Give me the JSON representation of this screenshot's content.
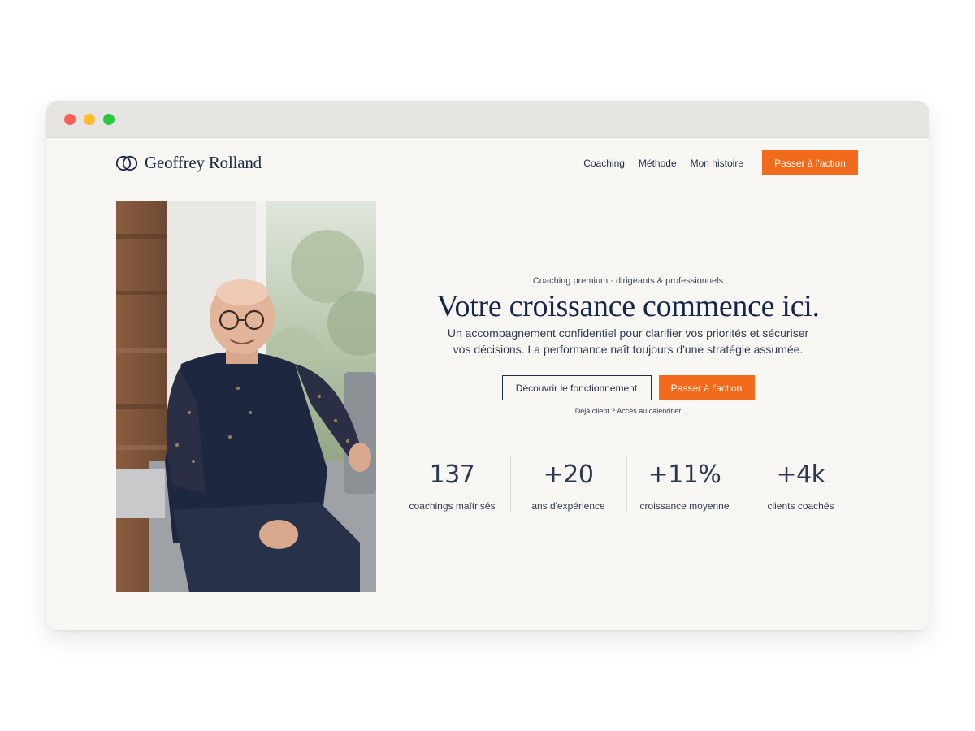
{
  "brand": {
    "name": "Geoffrey Rolland"
  },
  "nav": {
    "links": [
      "Coaching",
      "Méthode",
      "Mon histoire"
    ],
    "cta": "Passer à l'action"
  },
  "hero": {
    "eyebrow": "Coaching premium · dirigeants & professionnels",
    "title": "Votre croissance commence ici.",
    "subtitle": "Un accompagnement confidentiel pour clarifier vos priorités et sécuriser vos décisions. La performance naît toujours d'une stratégie assumée.",
    "primary_cta": "Passer à l'action",
    "secondary_cta": "Découvrir le fonctionnement",
    "client_link": "Déjà client ? Accès au calendrier"
  },
  "stats": [
    {
      "value": "137",
      "label": "coachings maîtrisés"
    },
    {
      "value": "+20",
      "label": "ans d'expérience"
    },
    {
      "value": "+11%",
      "label": "croissance moyenne"
    },
    {
      "value": "+4k",
      "label": "clients coachés"
    }
  ],
  "colors": {
    "accent": "#f26a1b",
    "navy": "#15264a",
    "page_bg": "#f9f7f4"
  },
  "photo": {
    "subject": "portrait-photo"
  }
}
